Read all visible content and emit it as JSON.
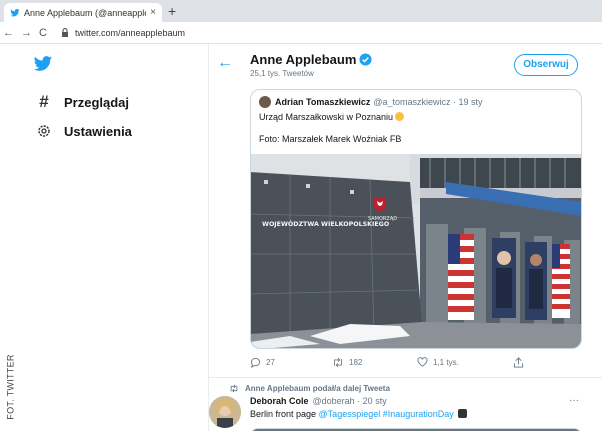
{
  "browser": {
    "tab_title": "Anne Applebaum (@anneapplel",
    "tab_close": "×",
    "new_tab": "+",
    "url": "twitter.com/anneapplebaum",
    "back": "←",
    "forward": "→",
    "reload": "C"
  },
  "nav": {
    "explore_label": "Przeglądaj",
    "settings_label": "Ustawienia"
  },
  "profile": {
    "name": "Anne Applebaum",
    "tweet_count": "25,1 tys. Tweetów",
    "follow_label": "Obserwuj"
  },
  "quote": {
    "author_name": "Adrian Tomaszkiewicz",
    "author_meta": "@a_tomaszkiewicz · 19 sty",
    "text_line1": "Urząd Marszałkowski w Poznaniu",
    "text_line2": "Foto: Marszałek Marek Woźniak FB",
    "photo": {
      "building_line1": "SAMORZĄD",
      "building_line2": "WOJEWÓDZTWA WIELKOPOLSKIEGO"
    }
  },
  "actions": {
    "replies": "27",
    "retweets": "182",
    "likes": "1,1 tys."
  },
  "retweet": {
    "label": "Anne Applebaum podał/a dalej Tweeta",
    "author_name": "Deborah Cole",
    "author_meta": "@doberah · 20 sty",
    "more": "···",
    "text_plain": "Berlin front page ",
    "mention": "@Tagesspiegel",
    "hashtag": "#InaugurationDay"
  },
  "credit": "FOT. TWITTER",
  "colors": {
    "accent": "#1da1f2",
    "secondary_text": "#657786",
    "border": "#ccd6dd"
  }
}
